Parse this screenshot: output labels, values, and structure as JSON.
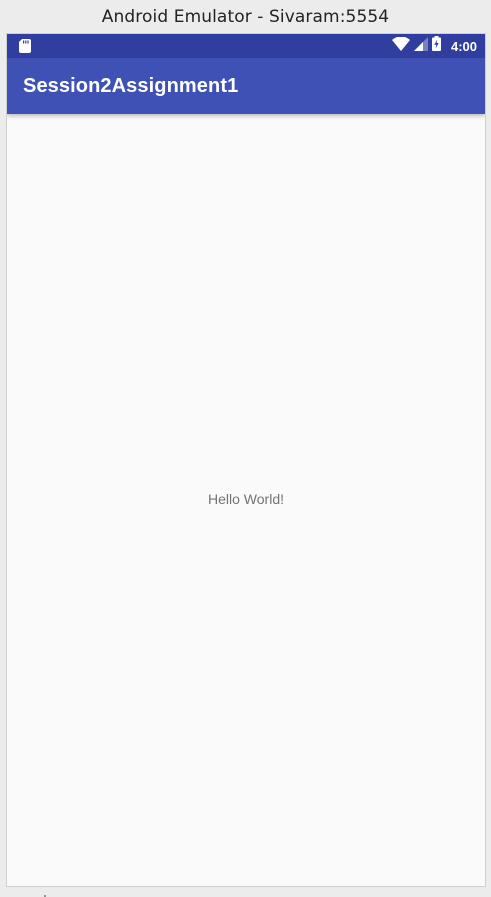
{
  "window": {
    "title": "Android Emulator - Sivaram:5554"
  },
  "status_bar": {
    "time": "4:00",
    "icons": [
      "sd-card-icon",
      "wifi-icon",
      "cell-signal-icon",
      "battery-charging-icon"
    ],
    "color": "#303f9f"
  },
  "app_bar": {
    "title": "Session2Assignment1",
    "color": "#3f51b5",
    "text_color": "#ffffff"
  },
  "content": {
    "text": "Hello World!",
    "background": "#fafafa",
    "text_color": "#737373"
  }
}
